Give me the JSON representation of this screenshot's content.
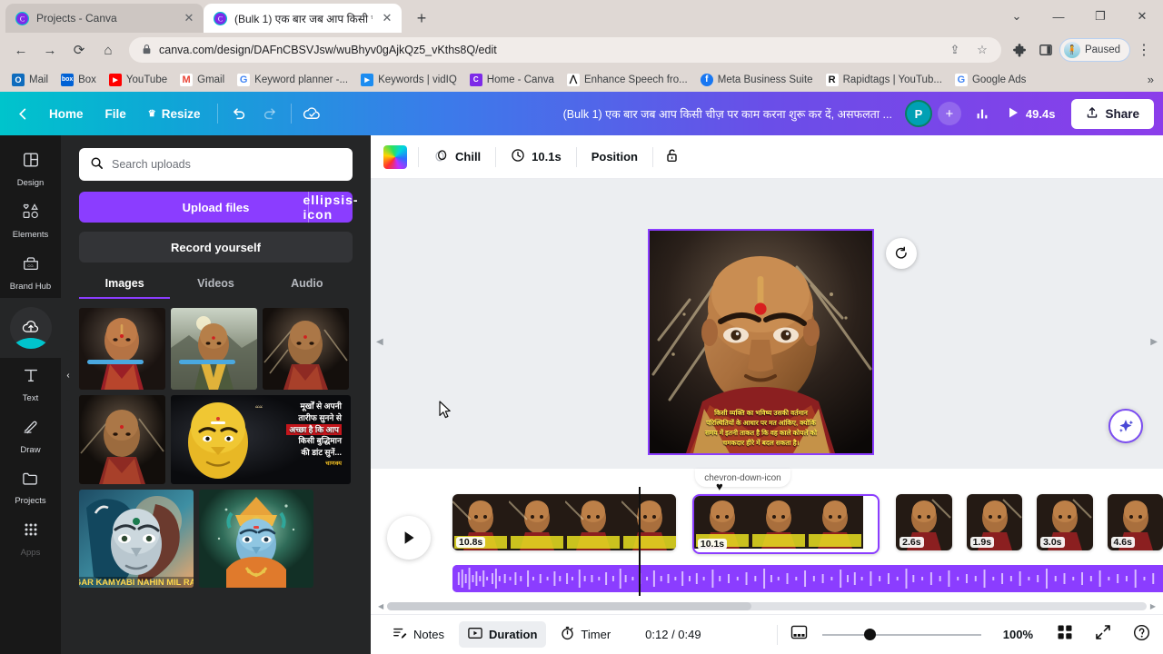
{
  "browser": {
    "tabs": [
      {
        "title": "Projects - Canva",
        "favicon": "canva-icon",
        "active": false
      },
      {
        "title": "(Bulk 1) एक बार जब आप किसी चीज़",
        "favicon": "canva-icon",
        "active": true
      }
    ],
    "new_tab_label": "+",
    "window_controls": {
      "chevron": "⌄",
      "minimize": "—",
      "maximize": "❐",
      "close": "✕"
    },
    "nav": {
      "back": "←",
      "forward": "→",
      "reload": "⟳",
      "home": "⌂"
    },
    "url": "canva.com/design/DAFnCBSVJsw/wuBhyv0gAjkQz5_vKths8Q/edit",
    "lock_icon": "lock-icon",
    "omnibox_actions": {
      "share": "share-icon",
      "bookmark": "star-icon"
    },
    "extensions_icon": "puzzle-icon",
    "sidepanel_icon": "sidepanel-icon",
    "profile_label": "Paused",
    "menu_icon": "kebab-menu-icon",
    "bookmarks": [
      {
        "label": "Mail",
        "icon": "outlook-icon",
        "color": "#0f6cbd",
        "glyph": "O"
      },
      {
        "label": "Box",
        "icon": "box-icon",
        "color": "#0061d5",
        "glyph": "b"
      },
      {
        "label": "YouTube",
        "icon": "youtube-icon",
        "color": "#ff0000",
        "glyph": "▶"
      },
      {
        "label": "Gmail",
        "icon": "gmail-icon",
        "color": "#ffffff",
        "glyph": "M"
      },
      {
        "label": "Keyword planner -...",
        "icon": "google-icon",
        "color": "#ffffff",
        "glyph": "G"
      },
      {
        "label": "Keywords | vidIQ",
        "icon": "vidiq-icon",
        "color": "#1c8cf0",
        "glyph": "▶"
      },
      {
        "label": "Home - Canva",
        "icon": "canva-icon",
        "color": "#00c4cc",
        "glyph": "C"
      },
      {
        "label": "Enhance Speech fro...",
        "icon": "adobe-icon",
        "color": "#111111",
        "glyph": "A"
      },
      {
        "label": "Meta Business Suite",
        "icon": "facebook-icon",
        "color": "#1877f2",
        "glyph": "f"
      },
      {
        "label": "Rapidtags | YouTub...",
        "icon": "rapidtags-icon",
        "color": "#ffffff",
        "glyph": "R"
      },
      {
        "label": "Google Ads",
        "icon": "google-icon",
        "color": "#ffffff",
        "glyph": "G"
      }
    ],
    "bookmarks_overflow": "»"
  },
  "canva_header": {
    "back_icon": "chevron-left-icon",
    "home_label": "Home",
    "file_label": "File",
    "resize_label": "Resize",
    "resize_icon": "crown-icon",
    "undo_icon": "undo-icon",
    "redo_icon": "redo-icon",
    "cloud_icon": "cloud-saved-icon",
    "doc_title": "(Bulk 1) एक बार जब आप किसी चीज़ पर काम करना शुरू कर दें, असफलता ...",
    "avatar_initial": "P",
    "add_collaborator": "+",
    "insights_icon": "bar-chart-icon",
    "play_icon": "play-icon",
    "duration_label": "49.4s",
    "share_label": "Share",
    "share_icon": "upload-arrow-icon",
    "gradient_from": "#00c4cc",
    "gradient_to": "#8b3dea"
  },
  "rail": {
    "items": [
      {
        "label": "Design",
        "icon": "layout-icon",
        "active": false
      },
      {
        "label": "Elements",
        "icon": "shapes-icon",
        "active": false
      },
      {
        "label": "Brand Hub",
        "icon": "brand-hub-icon",
        "active": false
      },
      {
        "label": "Uploads",
        "icon": "upload-cloud-icon",
        "active": true
      },
      {
        "label": "Text",
        "icon": "text-icon",
        "active": false
      },
      {
        "label": "Draw",
        "icon": "pen-icon",
        "active": false
      },
      {
        "label": "Projects",
        "icon": "folder-icon",
        "active": false
      },
      {
        "label": "Apps",
        "icon": "grid-dots-icon",
        "active": false
      }
    ]
  },
  "uploads_panel": {
    "search_placeholder": "Search uploads",
    "search_icon": "search-icon",
    "upload_button": "Upload files",
    "upload_more_icon": "ellipsis-icon",
    "record_button": "Record yourself",
    "tabs": [
      {
        "label": "Images",
        "active": true
      },
      {
        "label": "Videos",
        "active": false
      },
      {
        "label": "Audio",
        "active": false
      }
    ],
    "thumbnails": [
      {
        "name": "chanakya-portrait-1",
        "kind": "portrait"
      },
      {
        "name": "chanakya-mountain",
        "kind": "portrait-mountain"
      },
      {
        "name": "chanakya-portrait-2",
        "kind": "portrait"
      },
      {
        "name": "chanakya-portrait-3",
        "kind": "portrait"
      },
      {
        "name": "chanakya-quote-card",
        "kind": "quote-card",
        "quote_lines": [
          "मूर्खों से अपनी",
          "तारीफ सुनने से",
          "अच्छा है कि आप",
          "किसी बुद्धिमान",
          "की डांट सुनें..."
        ],
        "signature": "चाणक्य"
      },
      {
        "name": "shiva-artwork",
        "kind": "deity-blue",
        "caption": "AGAR KAMYABI NAHIN MIL RAHI"
      },
      {
        "name": "vishnu-artwork",
        "kind": "deity-gold"
      }
    ],
    "collapse_icon": "chevron-left-icon"
  },
  "canvas_toolbar": {
    "color_swatch": "rainbow-color-icon",
    "animation_label": "Chill",
    "animation_icon": "animation-icon",
    "timing_label": "10.1s",
    "timing_icon": "clock-icon",
    "position_label": "Position",
    "lock_label": "",
    "lock_icon": "unlock-icon"
  },
  "canvas": {
    "rotate_icon": "rotate-icon",
    "ai_icon": "magic-sparkle-icon",
    "quote_lines": [
      "किसी व्यक्ति का भविष्य उसकी वर्तमान",
      "परिस्थितियों के आधार पर मत आंकिए, क्योंकि",
      "समय में इतनी ताकत है कि वह काले कोयले को",
      "चमकदार हीरे में बदल सकता है।"
    ],
    "selection_color": "#8b3dff"
  },
  "timeline": {
    "expand_icon": "chevron-down-icon",
    "heart_icon": "heart-marker-icon",
    "play_icon": "play-icon",
    "groups": [
      {
        "name": "clip-group-1",
        "selected": false,
        "frames": 4,
        "duration": "10.8s"
      },
      {
        "name": "clip-group-2",
        "selected": true,
        "frames": 3,
        "duration": "10.1s"
      },
      {
        "name": "clip-3",
        "selected": false,
        "frames": 1,
        "duration": "2.6s"
      },
      {
        "name": "clip-4",
        "selected": false,
        "frames": 1,
        "duration": "1.9s"
      },
      {
        "name": "clip-5",
        "selected": false,
        "frames": 1,
        "duration": "3.0s"
      },
      {
        "name": "clip-6",
        "selected": false,
        "frames": 1,
        "duration": "4.6s"
      }
    ],
    "audio_track": {
      "name": "voiceover-track",
      "color": "#8b3dff"
    },
    "scroll_left_icon": "◀",
    "scroll_right_icon": "▶"
  },
  "statusbar": {
    "notes_label": "Notes",
    "notes_icon": "notes-icon",
    "duration_label": "Duration",
    "duration_icon": "duration-icon",
    "timer_label": "Timer",
    "timer_icon": "timer-icon",
    "timecode": "0:12 / 0:49",
    "pages_icon": "pages-icon",
    "zoom_value": "100%",
    "grid_icon": "grid-view-icon",
    "fullscreen_icon": "expand-icon",
    "help_icon": "help-icon"
  }
}
